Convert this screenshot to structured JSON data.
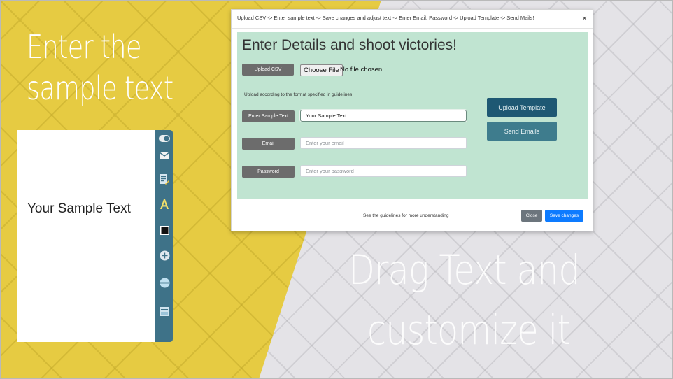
{
  "slide": {
    "left_heading_line1": "Enter the",
    "left_heading_line2": "sample text",
    "right_heading_line1": "Drag Text and",
    "right_heading_line2": "customize it"
  },
  "canvas": {
    "sample_text": "Your Sample Text"
  },
  "toolbar": {
    "icons": [
      "toggle-icon",
      "mail-icon",
      "edit-document-icon",
      "font-icon",
      "color-swatch-icon",
      "add-icon",
      "minus-icon",
      "image-icon"
    ]
  },
  "modal": {
    "title": "Upload CSV -> Enter sample text -> Save changes and adjust text -> Enter Email, Password -> Upload Template -> Send Mails!",
    "close_symbol": "×",
    "heading": "Enter Details and shoot victories!",
    "upload_csv_label": "Upload CSV",
    "choose_file_label": "Choose File",
    "file_status": "No file chosen",
    "upload_hint": "Upload according to the format specified in guidelines",
    "sample_text_label": "Enter Sample Text",
    "sample_text_value": "Your Sample Text",
    "email_label": "Email",
    "email_placeholder": "Enter your email",
    "password_label": "Password",
    "password_placeholder": "Enter your password",
    "upload_template_label": "Upload Template",
    "send_emails_label": "Send Emails",
    "footer_text": "See the guidelines for more understanding",
    "close_label": "Close",
    "save_label": "Save changes"
  },
  "colors": {
    "panel_bg": "#c0e4d1",
    "upload_template_bg": "#1e5873",
    "send_emails_bg": "#3e7c8d",
    "save_button": "#0d7bff",
    "close_button": "#6c757d",
    "toolbar_bg": "#3e7288"
  }
}
